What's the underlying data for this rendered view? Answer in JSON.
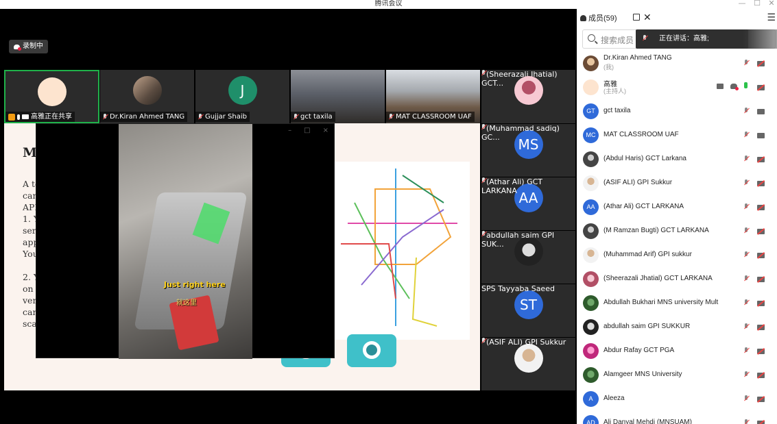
{
  "window": {
    "title": "腾讯会议",
    "min": "—",
    "max": "☐",
    "close": "✕"
  },
  "recording": {
    "label": "录制中"
  },
  "top_tiles": [
    {
      "name": "高雅正在共享",
      "kind": "avatar"
    },
    {
      "name": "Dr.Kiran Ahmed TANG",
      "kind": "photo"
    },
    {
      "name": "Gujjar Shaib",
      "kind": "letter",
      "letter": "J"
    },
    {
      "name": "gct taxila",
      "kind": "camera"
    },
    {
      "name": "MAT CLASSROOM UAF",
      "kind": "camera2"
    }
  ],
  "right_tiles": [
    {
      "name": "(Sheerazali Jhatial) GCT...",
      "kind": "photo"
    },
    {
      "name": "(Muhammad sadiq) GC...",
      "kind": "letter",
      "letter": "MS"
    },
    {
      "name": "(Athar Ali) GCT LARKANA",
      "kind": "letter",
      "letter": "AA"
    },
    {
      "name": "abdullah saim GPI SUK...",
      "kind": "photo"
    },
    {
      "name": "SPS Tayyaba Saeed",
      "kind": "letter",
      "letter": "ST"
    },
    {
      "name": "(ASIF ALI) GPI Sukkur",
      "kind": "photo"
    }
  ],
  "slide": {
    "heading": "M",
    "lines": [
      "A to",
      "can",
      "API",
      "1. Y",
      "serv",
      "app",
      "You",
      "",
      "2. Y",
      "on '",
      "veri",
      "can",
      "scar"
    ]
  },
  "video": {
    "caption_en": "Just right here",
    "caption_zh": "就这里",
    "ctrl_min": "–",
    "ctrl_max": "□",
    "ctrl_close": "×"
  },
  "sidebar": {
    "title": "成员(59)",
    "close": "✕",
    "menu": "☰",
    "search_placeholder": "搜索成员",
    "speaking": "正在讲话：高雅;",
    "members": [
      {
        "name": "Dr.Kiran Ahmed TANG",
        "sub": "(我)",
        "av": "ph1",
        "cam": "off"
      },
      {
        "name": "高雅",
        "sub": "(主持人)",
        "av": "ph2",
        "cam": "off",
        "host": true
      },
      {
        "name": "gct taxila",
        "av": "txt",
        "initials": "GT",
        "cam": "on"
      },
      {
        "name": "MAT CLASSROOM UAF",
        "av": "txt",
        "initials": "MC",
        "cam": "on"
      },
      {
        "name": "(Abdul Haris) GCT Larkana",
        "av": "ph3",
        "cam": "off"
      },
      {
        "name": "(ASIF ALI) GPI Sukkur",
        "av": "ph4",
        "cam": "off"
      },
      {
        "name": "(Athar Ali) GCT LARKANA",
        "av": "txt",
        "initials": "AA",
        "cam": "off"
      },
      {
        "name": "(M Ramzan Bugti) GCT LARKANA",
        "av": "ph3",
        "cam": "off"
      },
      {
        "name": "(Muhammad Arif) GPI sukkur",
        "av": "ph4",
        "cam": "off"
      },
      {
        "name": "(Sheerazali Jhatial) GCT LARKANA",
        "av": "ph5",
        "cam": "off"
      },
      {
        "name": "Abdullah Bukhari MNS university Mult",
        "av": "ph6",
        "cam": "off"
      },
      {
        "name": "abdullah saim GPI SUKKUR",
        "av": "ph7",
        "cam": "off"
      },
      {
        "name": "Abdur Rafay GCT PGA",
        "av": "ph8",
        "cam": "off"
      },
      {
        "name": "Alamgeer MNS University",
        "av": "ph6",
        "cam": "off"
      },
      {
        "name": "Aleeza",
        "av": "txt",
        "initials": "A",
        "cam": "off"
      },
      {
        "name": "Ali Danyal Mehdi (MNSUAM)",
        "av": "txt",
        "initials": "AD",
        "cam": "off"
      }
    ]
  }
}
